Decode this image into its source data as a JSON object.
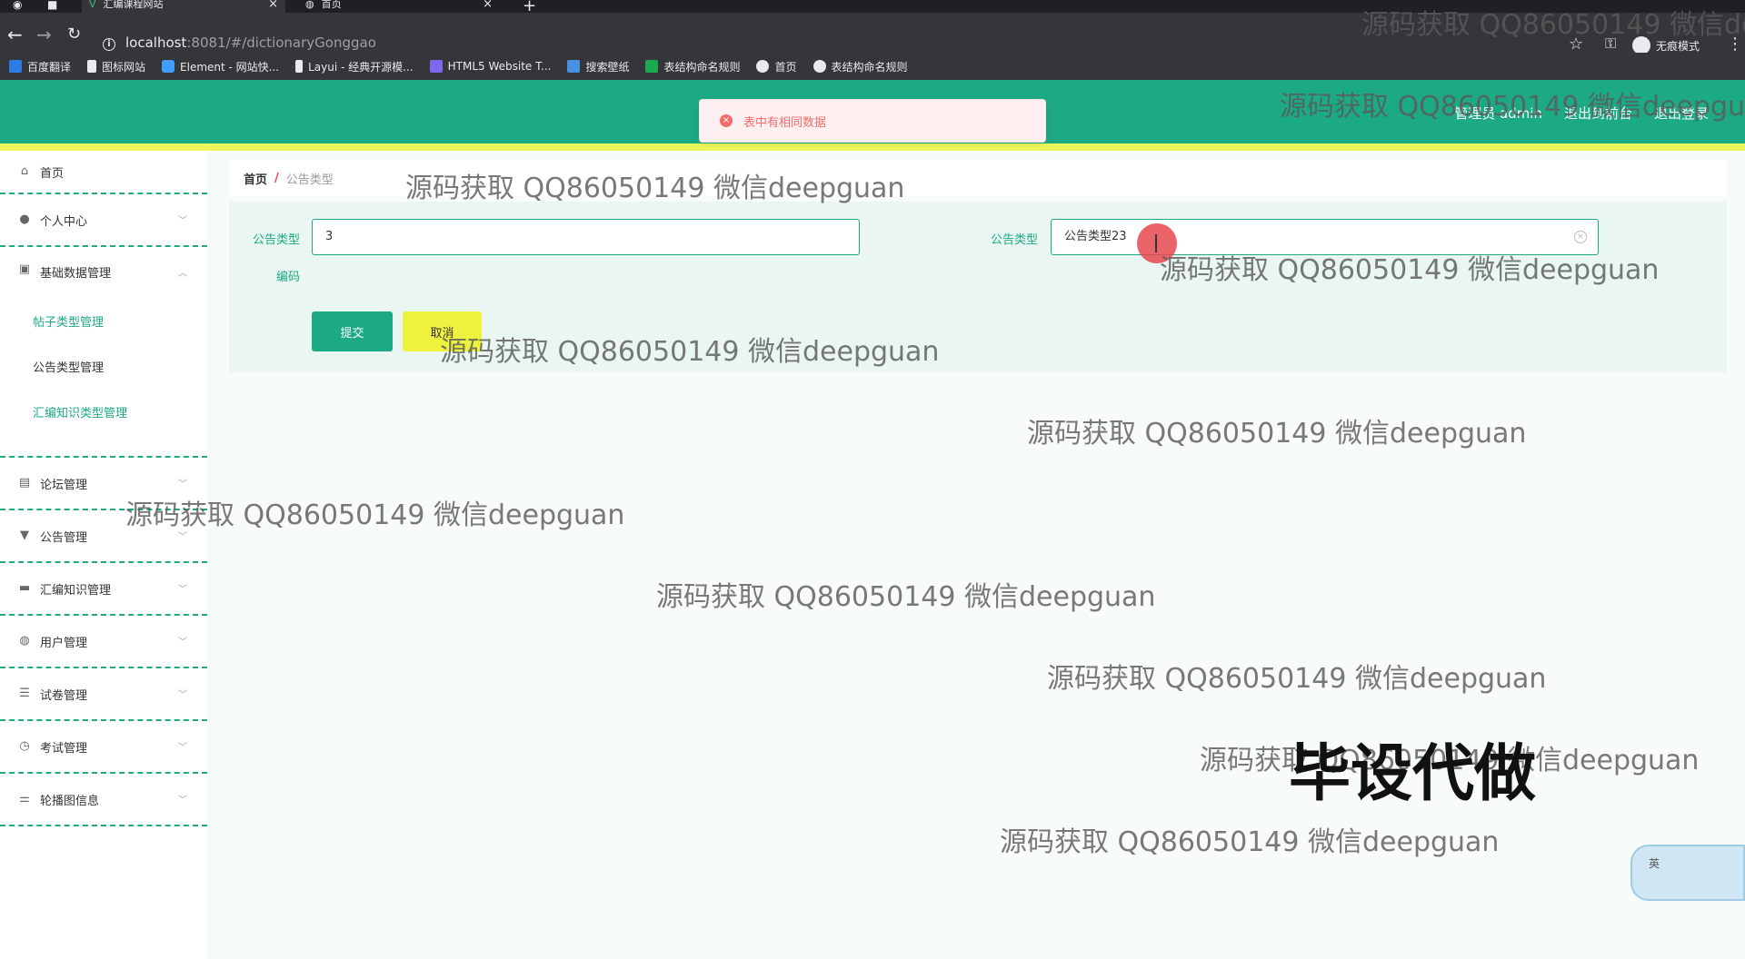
{
  "browser": {
    "tabs": [
      {
        "label": "汇编课程网站",
        "active": true
      },
      {
        "label": "首页",
        "active": false
      }
    ],
    "url_host": "localhost",
    "url_rest": ":8081/#/dictionaryGonggao",
    "incognito_label": "无痕模式",
    "bookmarks": [
      {
        "label": "百度翻译",
        "color": "#2f7be5"
      },
      {
        "label": "图标网站",
        "color": "#ffffff"
      },
      {
        "label": "Element - 网站快...",
        "color": "#409eff"
      },
      {
        "label": "Layui - 经典开源模...",
        "color": "#e8eaed"
      },
      {
        "label": "HTML5 Website T...",
        "color": "#7b68ee"
      },
      {
        "label": "搜索壁纸",
        "color": "#4a90e2"
      },
      {
        "label": "表结构命名规则",
        "color": "#1caa50"
      },
      {
        "label": "首页",
        "color": "#e8eaed"
      },
      {
        "label": "表结构命名规则",
        "color": "#e8eaed"
      }
    ]
  },
  "header": {
    "links": [
      "管理员 admin",
      "退出到前台",
      "退出登录"
    ],
    "accent": "#1caa84"
  },
  "toast": {
    "message": "表中有相同数据",
    "color": "#f56c6c"
  },
  "sidebar": {
    "items": [
      {
        "label": "首页",
        "icon": "home-icon"
      },
      {
        "label": "个人中心",
        "icon": "user-icon"
      },
      {
        "label": "基础数据管理",
        "icon": "database-icon"
      },
      {
        "label": "论坛管理",
        "icon": "clipboard-icon"
      },
      {
        "label": "公告管理",
        "icon": "megaphone-icon"
      },
      {
        "label": "汇编知识管理",
        "icon": "briefcase-icon"
      },
      {
        "label": "用户管理",
        "icon": "globe-icon"
      },
      {
        "label": "试卷管理",
        "icon": "list-icon"
      },
      {
        "label": "考试管理",
        "icon": "clock-icon"
      },
      {
        "label": "轮播图信息",
        "icon": "sliders-icon"
      }
    ],
    "sub_items": [
      "帖子类型管理",
      "公告类型管理",
      "汇编知识类型管理"
    ]
  },
  "breadcrumb": {
    "home": "首页",
    "separator": "/",
    "current": "公告类型"
  },
  "form": {
    "code_label_line1": "公告类型",
    "code_label_line2": "编码",
    "code_value": "3",
    "name_label": "公告类型",
    "name_value": "公告类型23",
    "submit_label": "提交",
    "cancel_label": "取消"
  },
  "watermark": {
    "text": "源码获取 QQ86050149 微信deepguan",
    "big_text": "毕设代做"
  },
  "ime": {
    "label": "英"
  }
}
